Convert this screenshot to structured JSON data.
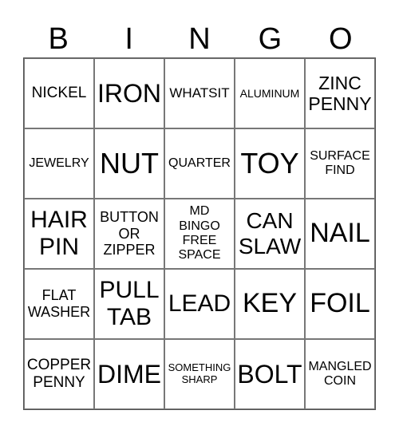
{
  "header": [
    "B",
    "I",
    "N",
    "G",
    "O"
  ],
  "card": {
    "rows": [
      [
        "NICKEL",
        "IRON",
        "WHATSIT",
        "ALUMINUM",
        "ZINC\nPENNY"
      ],
      [
        "JEWELRY",
        "NUT",
        "QUARTER",
        "TOY",
        "SURFACE\nFIND"
      ],
      [
        "HAIR\nPIN",
        "BUTTON\nOR\nZIPPER",
        "MD\nBINGO\nFREE\nSPACE",
        "CAN\nSLAW",
        "NAIL"
      ],
      [
        "FLAT\nWASHER",
        "PULL\nTAB",
        "LEAD",
        "KEY",
        "FOIL"
      ],
      [
        "COPPER\nPENNY",
        "DIME",
        "SOMETHING\nSHARP",
        "BOLT",
        "MANGLED\nCOIN"
      ]
    ]
  }
}
